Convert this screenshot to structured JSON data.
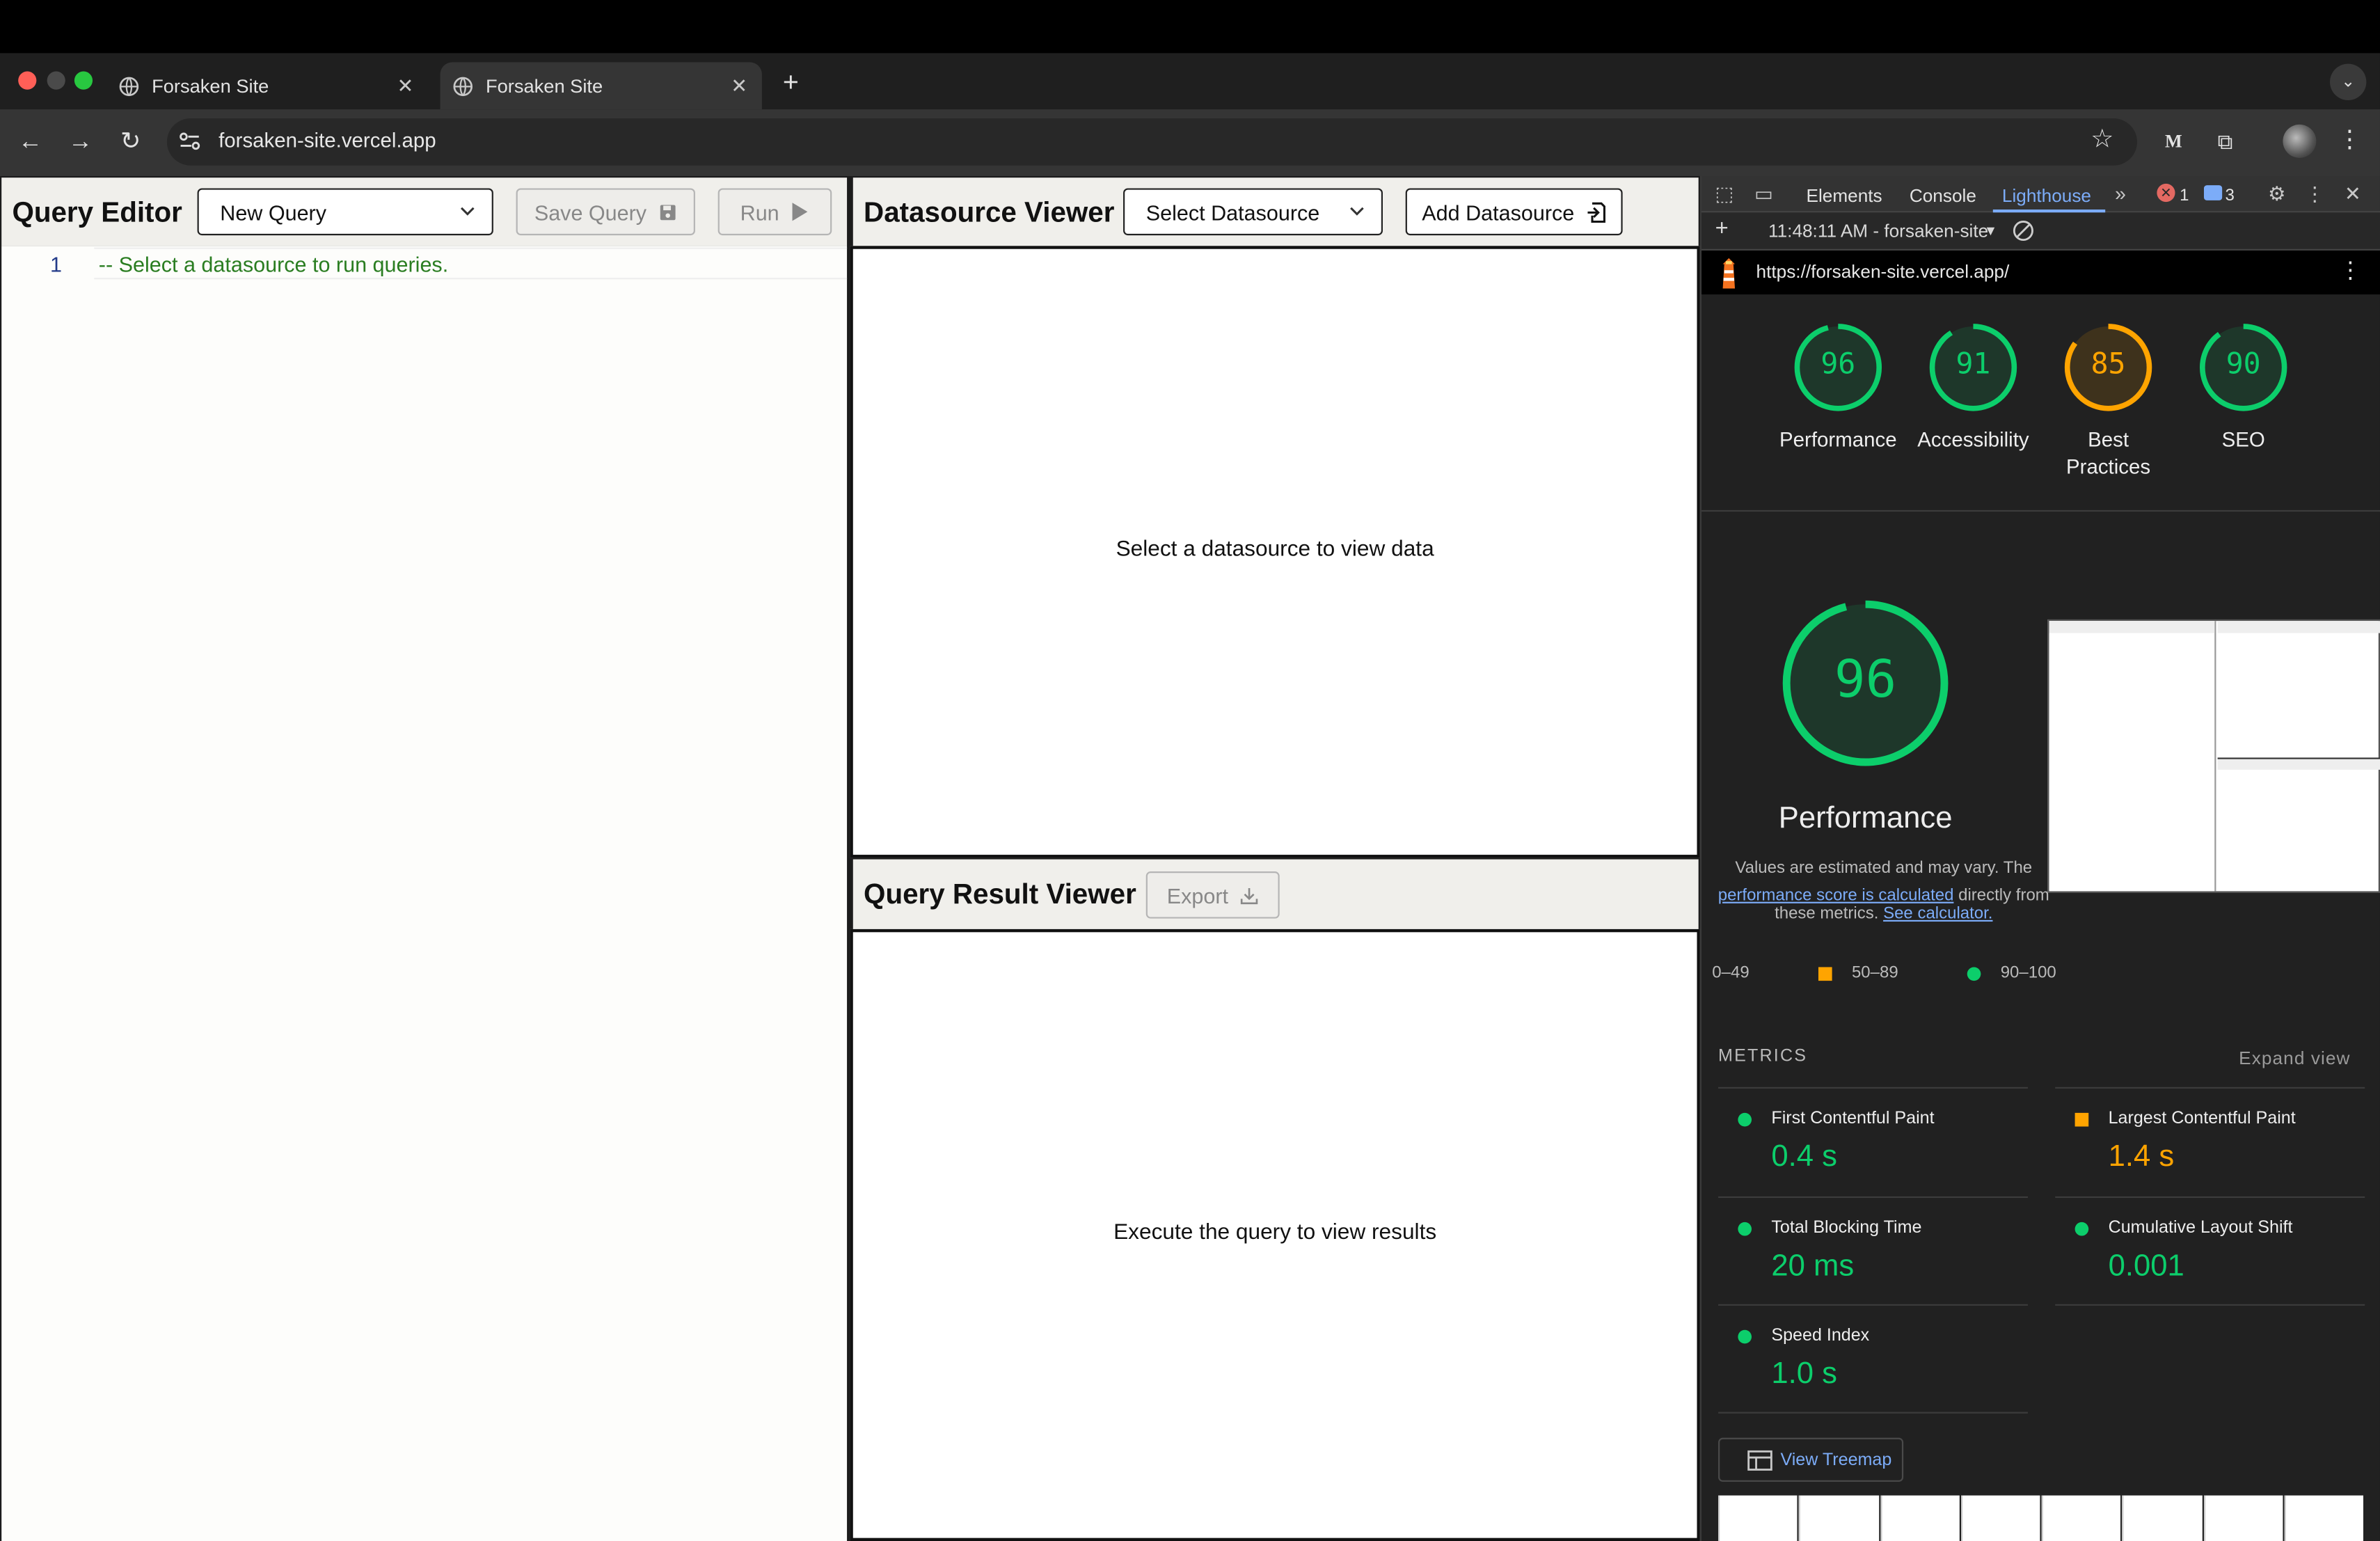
{
  "browser": {
    "tabs": [
      {
        "title": "Forsaken Site",
        "active": false
      },
      {
        "title": "Forsaken Site",
        "active": true
      }
    ],
    "url": "forsaken-site.vercel.app"
  },
  "query_editor": {
    "title": "Query Editor",
    "query_select": "New Query",
    "save_label": "Save Query",
    "run_label": "Run",
    "line_number": "1",
    "code_line": "-- Select a datasource to run queries."
  },
  "datasource_viewer": {
    "title": "Datasource Viewer",
    "select_label": "Select Datasource",
    "add_label": "Add Datasource",
    "empty_message": "Select a datasource to view data"
  },
  "result_viewer": {
    "title": "Query Result Viewer",
    "export_label": "Export",
    "empty_message": "Execute the query to view results"
  },
  "devtools": {
    "tabs": [
      "Elements",
      "Console",
      "Lighthouse"
    ],
    "active_tab": "Lighthouse",
    "error_count": "1",
    "message_count": "3",
    "report_label": "11:48:11 AM - forsaken-site",
    "report_url": "https://forsaken-site.vercel.app/"
  },
  "lighthouse": {
    "scores": [
      {
        "label": "Performance",
        "score": 96,
        "color": "#0cce6b"
      },
      {
        "label": "Accessibility",
        "score": 91,
        "color": "#0cce6b"
      },
      {
        "label": "Best Practices",
        "score": 85,
        "color": "#ffa400"
      },
      {
        "label": "SEO",
        "score": 90,
        "color": "#0cce6b"
      }
    ],
    "big_score": 96,
    "big_label": "Performance",
    "note_prefix": "Values are estimated and may vary. The",
    "note_link": "performance score is calculated",
    "note_mid": "directly from these metrics.",
    "note_link2": "See calculator.",
    "legend": [
      "0–49",
      "50–89",
      "90–100"
    ],
    "metrics_heading": "METRICS",
    "expand_label": "Expand view",
    "metrics": [
      {
        "name": "First Contentful Paint",
        "value": "0.4 s",
        "status": "good"
      },
      {
        "name": "Largest Contentful Paint",
        "value": "1.4 s",
        "status": "average"
      },
      {
        "name": "Total Blocking Time",
        "value": "20 ms",
        "status": "good"
      },
      {
        "name": "Cumulative Layout Shift",
        "value": "0.001",
        "status": "good"
      },
      {
        "name": "Speed Index",
        "value": "1.0 s",
        "status": "good"
      }
    ],
    "treemap_label": "View Treemap"
  },
  "colors": {
    "good": "#0cce6b",
    "average": "#ffa400",
    "link": "#7cacf8"
  }
}
